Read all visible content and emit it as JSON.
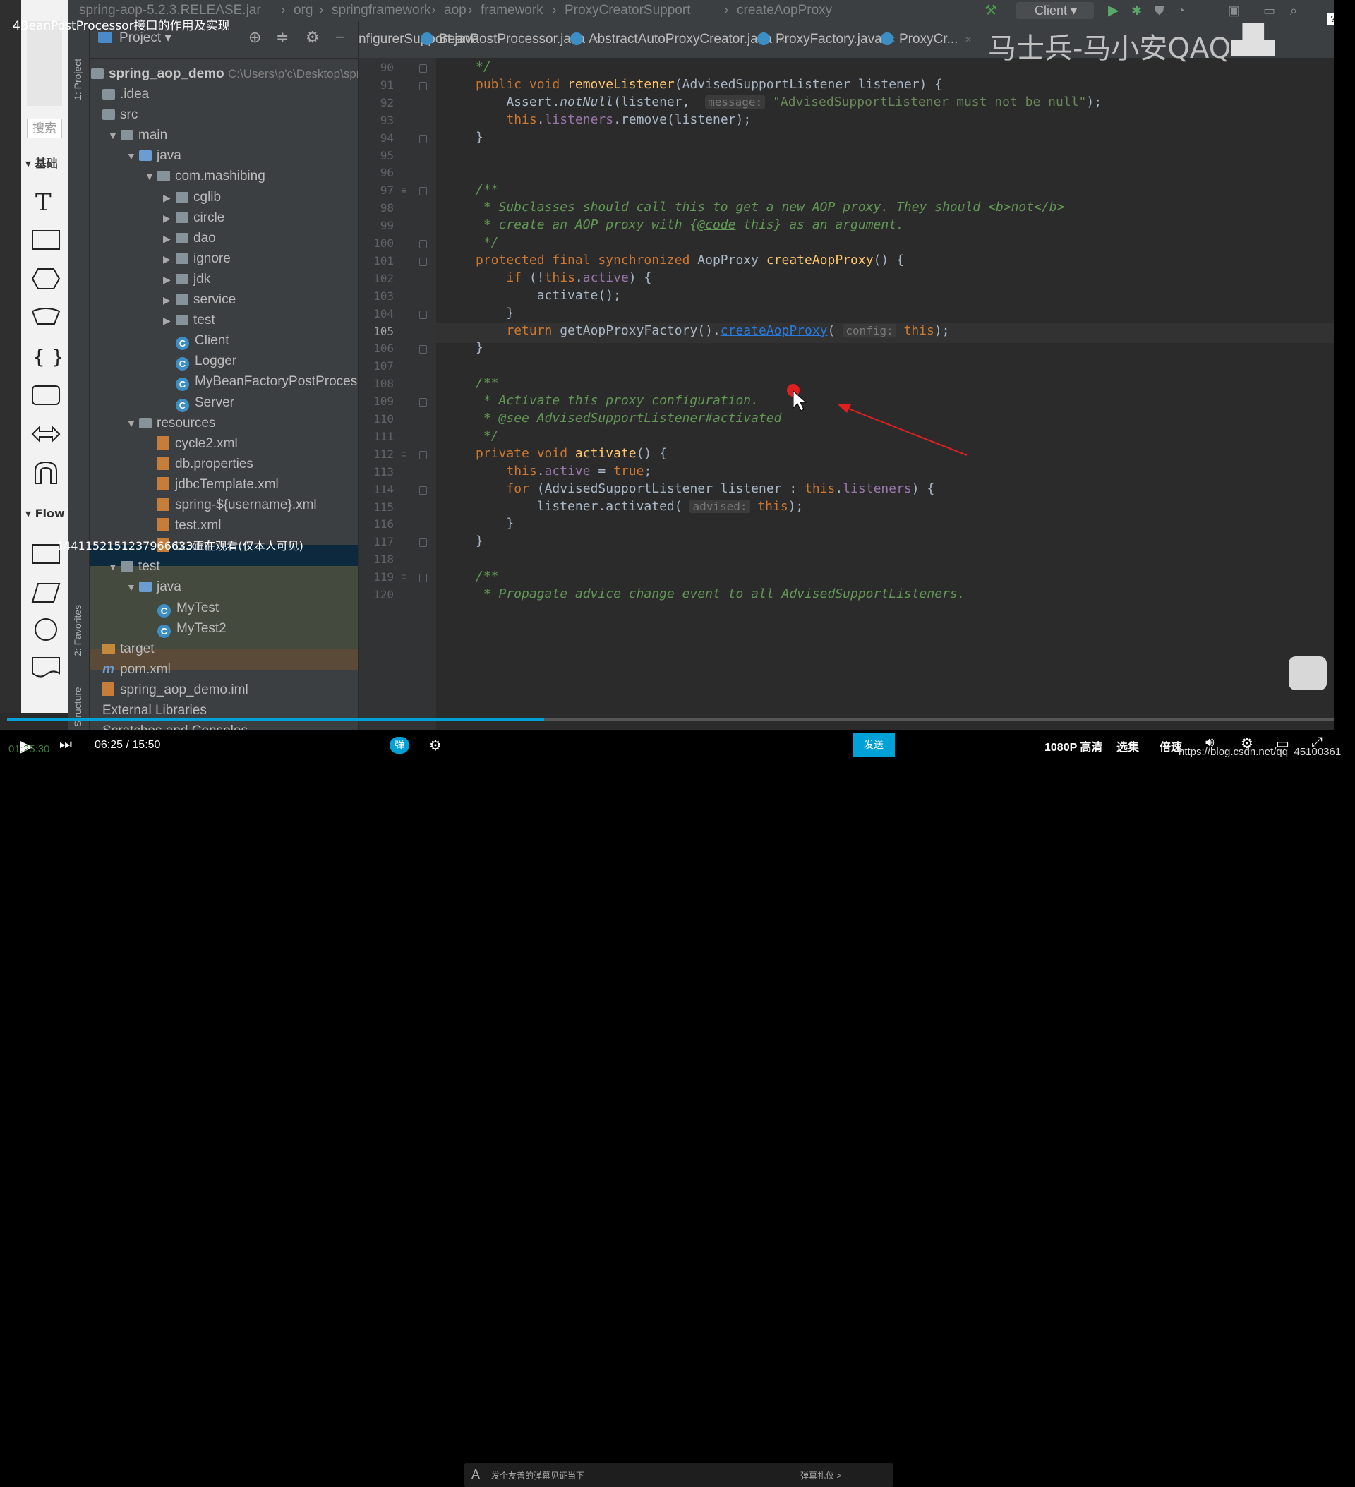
{
  "video_title": "4BeanPostProcessor接口的作用及实现",
  "breadcrumb": [
    "spring-aop-5.2.3.RELEASE.jar",
    "org",
    "springframework",
    "aop",
    "framework",
    "ProxyCreatorSupport",
    "createAopProxy"
  ],
  "run_config": "Client",
  "palette": {
    "search_placeholder": "搜索",
    "sections": [
      "基础",
      "Flow"
    ]
  },
  "toolstrip": {
    "project_label": "1: Project",
    "favorites_label": "2: Favorites",
    "structure_label": "Structure"
  },
  "project_panel": {
    "header_label": "Project",
    "root_name": "spring_aop_demo",
    "root_path": "C:\\Users\\p'c\\Desktop\\spri",
    "items": [
      {
        "label": ".idea",
        "depth": 0,
        "kind": "folder",
        "arrow": ""
      },
      {
        "label": "src",
        "depth": 0,
        "kind": "folder",
        "arrow": ""
      },
      {
        "label": "main",
        "depth": 1,
        "kind": "folder",
        "arrow": "▼"
      },
      {
        "label": "java",
        "depth": 2,
        "kind": "folder-blue",
        "arrow": "▼"
      },
      {
        "label": "com.mashibing",
        "depth": 3,
        "kind": "folder",
        "arrow": "▼"
      },
      {
        "label": "cglib",
        "depth": 4,
        "kind": "folder",
        "arrow": "▶"
      },
      {
        "label": "circle",
        "depth": 4,
        "kind": "folder",
        "arrow": "▶"
      },
      {
        "label": "dao",
        "depth": 4,
        "kind": "folder",
        "arrow": "▶"
      },
      {
        "label": "ignore",
        "depth": 4,
        "kind": "folder",
        "arrow": "▶"
      },
      {
        "label": "jdk",
        "depth": 4,
        "kind": "folder",
        "arrow": "▶"
      },
      {
        "label": "service",
        "depth": 4,
        "kind": "folder",
        "arrow": "▶"
      },
      {
        "label": "test",
        "depth": 4,
        "kind": "folder",
        "arrow": "▶"
      },
      {
        "label": "Client",
        "depth": 4,
        "kind": "class",
        "arrow": ""
      },
      {
        "label": "Logger",
        "depth": 4,
        "kind": "class",
        "arrow": ""
      },
      {
        "label": "MyBeanFactoryPostProcessor",
        "depth": 4,
        "kind": "class",
        "arrow": ""
      },
      {
        "label": "Server",
        "depth": 4,
        "kind": "class",
        "arrow": ""
      },
      {
        "label": "resources",
        "depth": 2,
        "kind": "folder",
        "arrow": "▼"
      },
      {
        "label": "cycle2.xml",
        "depth": 3,
        "kind": "xml",
        "arrow": ""
      },
      {
        "label": "db.properties",
        "depth": 3,
        "kind": "xml",
        "arrow": ""
      },
      {
        "label": "jdbcTemplate.xml",
        "depth": 3,
        "kind": "xml",
        "arrow": ""
      },
      {
        "label": "spring-${username}.xml",
        "depth": 3,
        "kind": "xml",
        "arrow": ""
      },
      {
        "label": "test.xml",
        "depth": 3,
        "kind": "xml",
        "arrow": ""
      },
      {
        "label": "tx.xml",
        "depth": 3,
        "kind": "xml",
        "arrow": ""
      },
      {
        "label": "test",
        "depth": 1,
        "kind": "folder",
        "arrow": "▼"
      },
      {
        "label": "java",
        "depth": 2,
        "kind": "folder-blue",
        "arrow": "▼"
      },
      {
        "label": "MyTest",
        "depth": 3,
        "kind": "class",
        "arrow": ""
      },
      {
        "label": "MyTest2",
        "depth": 3,
        "kind": "class",
        "arrow": ""
      },
      {
        "label": "target",
        "depth": 0,
        "kind": "folder-orange",
        "arrow": ""
      },
      {
        "label": "pom.xml",
        "depth": 0,
        "kind": "pom",
        "arrow": ""
      },
      {
        "label": "spring_aop_demo.iml",
        "depth": 0,
        "kind": "xml",
        "arrow": ""
      },
      {
        "label": "External Libraries",
        "depth": -1,
        "kind": "none",
        "arrow": ""
      },
      {
        "label": "Scratches and Consoles",
        "depth": -1,
        "kind": "none",
        "arrow": ""
      }
    ]
  },
  "tabs": [
    {
      "label": "nfigurerSupport.java"
    },
    {
      "label": "BeanPostProcessor.java"
    },
    {
      "label": "AbstractAutoProxyCreator.java"
    },
    {
      "label": "ProxyFactory.java"
    },
    {
      "label": "ProxyCr..."
    }
  ],
  "editor": {
    "current_line": "105",
    "lines": [
      {
        "n": "90",
        "html": "<span class='cm'>*/</span>"
      },
      {
        "n": "91",
        "html": "<span class='kw'>public void </span><span class='fn'>removeListener</span>(AdvisedSupportListener listener) {"
      },
      {
        "n": "92",
        "html": "    Assert.<span class='ital'>notNull</span>(listener,  <span class='hint'>message:</span> <span class='st'>\"AdvisedSupportListener must not be null\"</span>);"
      },
      {
        "n": "93",
        "html": "    <span class='kw'>this</span>.<span class='fld'>listeners</span>.remove(listener);"
      },
      {
        "n": "94",
        "html": "}"
      },
      {
        "n": "95",
        "html": ""
      },
      {
        "n": "96",
        "html": ""
      },
      {
        "n": "97",
        "html": "<span class='cm'>/**</span>"
      },
      {
        "n": "98",
        "html": "<span class='cm'> * Subclasses should call this to get a new AOP proxy. They should &lt;b&gt;not&lt;/b&gt;</span>"
      },
      {
        "n": "99",
        "html": "<span class='cm'> * create an AOP proxy with {<span class='lnk' style='color:#629755'>@code</span> this} as an argument.</span>"
      },
      {
        "n": "100",
        "html": "<span class='cm'> */</span>"
      },
      {
        "n": "101",
        "html": "<span class='kw'>protected final synchronized </span>AopProxy <span class='fn'>createAopProxy</span>() {"
      },
      {
        "n": "102",
        "html": "    <span class='kw'>if </span>(!<span class='kw'>this</span>.<span class='fld'>active</span>) {"
      },
      {
        "n": "103",
        "html": "        activate();"
      },
      {
        "n": "104",
        "html": "    }"
      },
      {
        "n": "105",
        "html": "    <span class='kw'>return </span>getAopProxyFactory().<span class='lnk'>createAopProxy</span>( <span class='hint'>config:</span> <span class='kw'>this</span>);"
      },
      {
        "n": "106",
        "html": "}"
      },
      {
        "n": "107",
        "html": ""
      },
      {
        "n": "108",
        "html": "<span class='cm'>/**</span>"
      },
      {
        "n": "109",
        "html": "<span class='cm'> * Activate this proxy configuration.</span>"
      },
      {
        "n": "110",
        "html": "<span class='cm'> * <span class='lnk' style='color:#629755'>@see</span> AdvisedSupportListener#activated</span>"
      },
      {
        "n": "111",
        "html": "<span class='cm'> */</span>"
      },
      {
        "n": "112",
        "html": "<span class='kw'>private void </span><span class='fn'>activate</span>() {"
      },
      {
        "n": "113",
        "html": "    <span class='kw'>this</span>.<span class='fld'>active</span> = <span class='kw'>true</span>;"
      },
      {
        "n": "114",
        "html": "    <span class='kw'>for </span>(AdvisedSupportListener listener : <span class='kw'>this</span>.<span class='fld'>listeners</span>) {"
      },
      {
        "n": "115",
        "html": "        listener.activated( <span class='hint'>advised:</span> <span class='kw'>this</span>);"
      },
      {
        "n": "116",
        "html": "    }"
      },
      {
        "n": "117",
        "html": "}"
      },
      {
        "n": "118",
        "html": ""
      },
      {
        "n": "119",
        "html": "<span class='cm'>/**</span>"
      },
      {
        "n": "120",
        "html": "<span class='cm'> * Propagate advice change event to all AdvisedSupportListeners.</span>"
      }
    ]
  },
  "overlay": {
    "watermark": "马士兵-马小安QAQ",
    "viewer_note": "1441152151237966633正在观看(仅本人可见)"
  },
  "player": {
    "time_current": "06:25",
    "time_total": "15:50",
    "side_time": "01:25:30",
    "danmaku_placeholder": "发个友善的弹幕见证当下",
    "danmaku_etiquette": "弹幕礼仪 >",
    "send_label": "发送",
    "quality": "1080P 高清",
    "episodes": "选集",
    "speed": "倍速",
    "url_overlay": "https://blog.csdn.net/qq_45100361",
    "progress_fraction": 0.405,
    "accent_color": "#00a1d6"
  }
}
